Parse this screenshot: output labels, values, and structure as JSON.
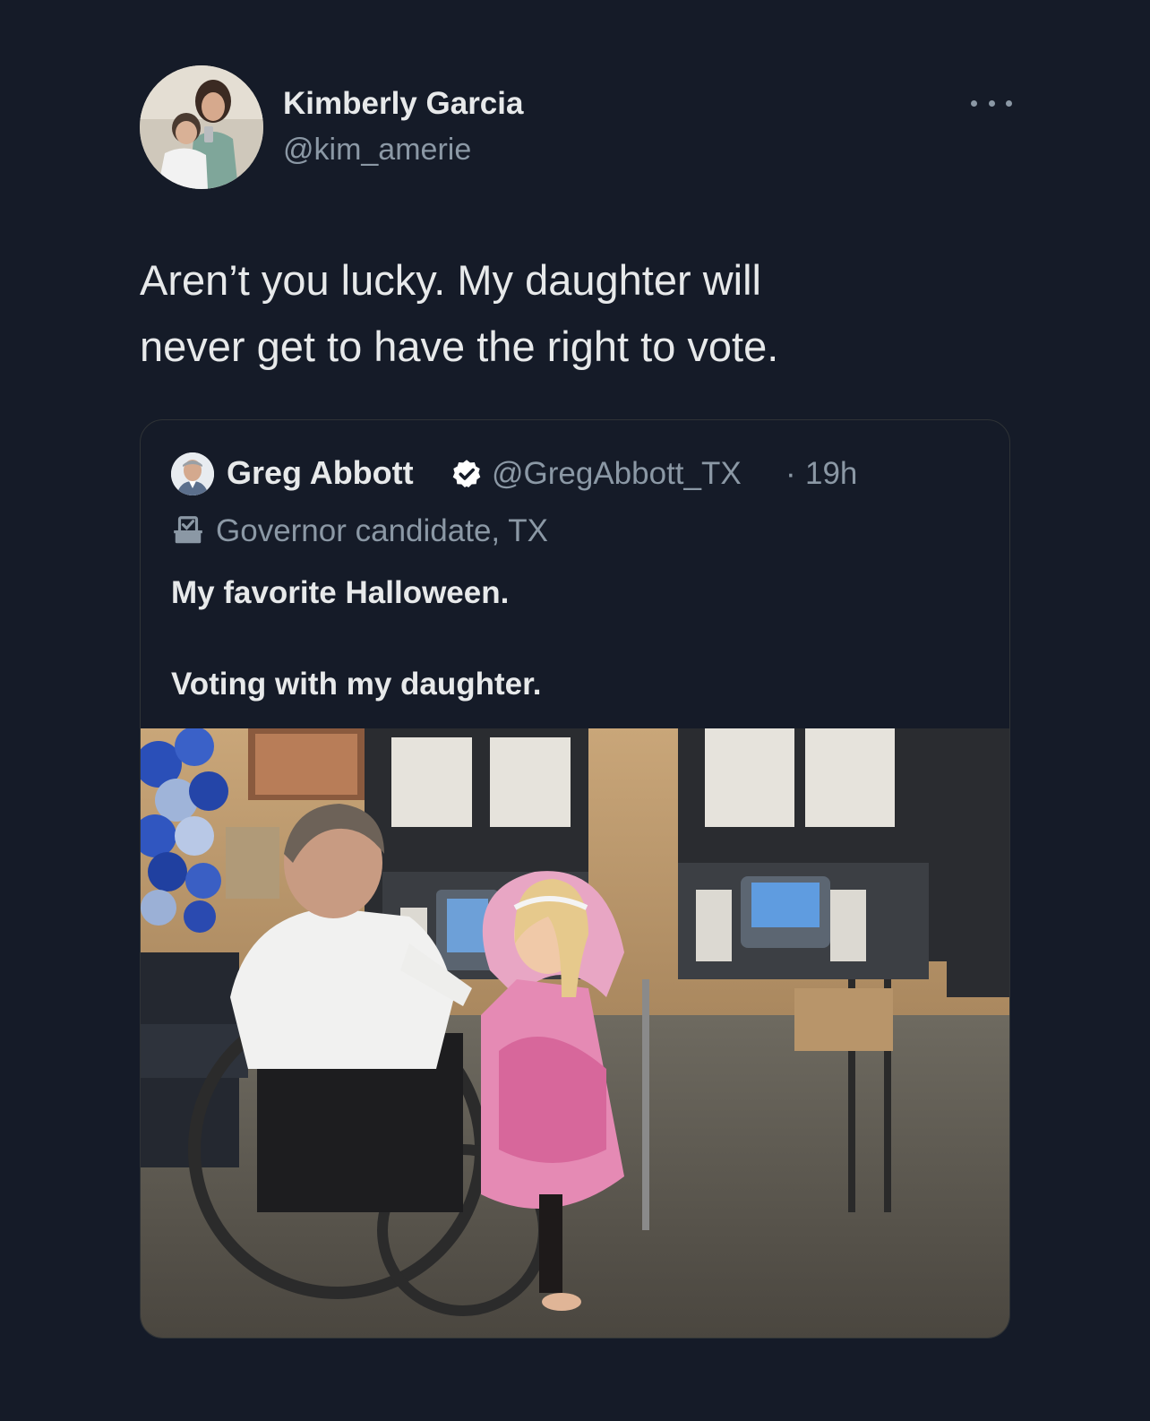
{
  "tweet": {
    "author": {
      "name": "Kimberly Garcia",
      "handle": "@kim_amerie",
      "avatar_icon": "profile-photo"
    },
    "text_line1": "Aren’t you lucky. My daughter will",
    "text_line2": "never get to have the right to vote.",
    "more_icon": "more-horizontal-icon"
  },
  "quote": {
    "author": {
      "name": "Greg Abbott",
      "handle": "@GregAbbott_TX",
      "separator": "·",
      "time": "19h",
      "verified_icon": "verified-badge-icon",
      "verified_color": "#ffffff"
    },
    "label_icon": "ballot-box-icon",
    "label": "Governor candidate, TX",
    "text_line1": "My favorite Halloween.",
    "text_line2": "Voting with my daughter.",
    "media_icon": "photo-voting-booths"
  },
  "colors": {
    "background": "#151b28",
    "primary_text": "#e7e9ea",
    "secondary_text": "#8b98a5",
    "card_border": "#2f3336"
  }
}
